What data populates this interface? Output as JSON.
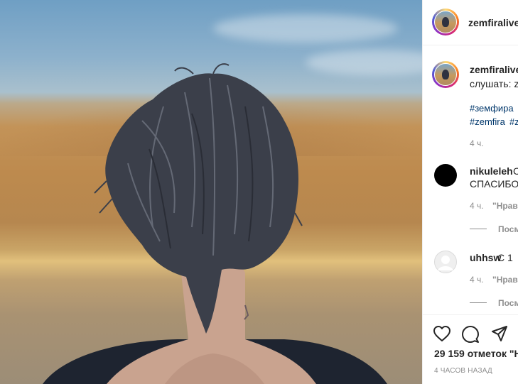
{
  "post": {
    "image_alt": "photo",
    "author": "zemfiralive"
  },
  "header": {
    "username": "zemfiralive"
  },
  "caption": {
    "username": "zemfiralive",
    "text": "слушать: ze",
    "hashtags_line1": "#земфира",
    "hashtags_line2a": "#zemfira",
    "hashtags_line2b": "#z",
    "time": "4 ч."
  },
  "comments": [
    {
      "username": "nikuleleh",
      "text_inline": "С",
      "text_line2": "СПАСИБО",
      "time": "4 ч.",
      "reply_label": "\"Нрави",
      "view_replies": "Посм"
    },
    {
      "username": "uhhsw",
      "text_inline": "С 1",
      "time": "4 ч.",
      "reply_label": "\"Нрави",
      "view_replies": "Посм"
    }
  ],
  "actions": {
    "icons": [
      "heart-icon",
      "comment-icon",
      "share-icon"
    ],
    "likes": "29 159 отметок \"Н",
    "date": "4 ЧАСОВ НАЗАД"
  }
}
